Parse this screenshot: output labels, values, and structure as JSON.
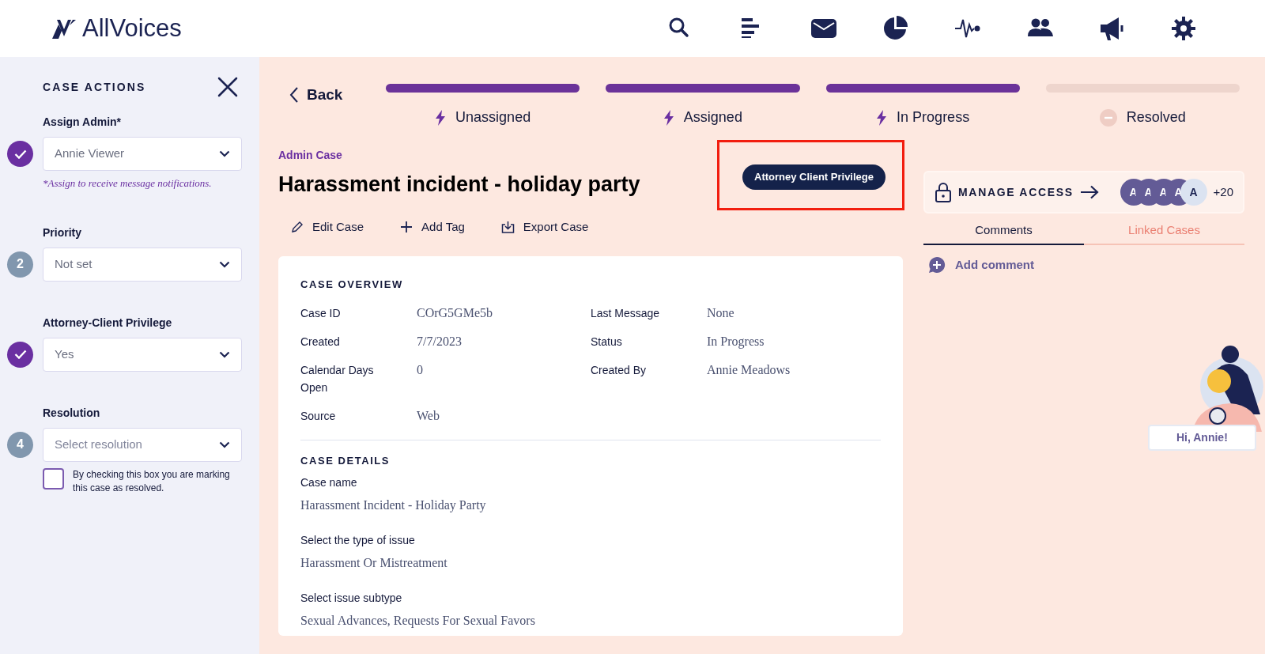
{
  "header": {
    "logo_text": "AllVoices"
  },
  "sidebar": {
    "title": "CASE ACTIONS",
    "steps": [
      {
        "label": "Assign Admin*",
        "value": "Annie Viewer",
        "completed": true,
        "hint": "*Assign to receive message notifications."
      },
      {
        "label": "Priority",
        "value": "Not set",
        "completed": false,
        "number": "2"
      },
      {
        "label": "Attorney-Client Privilege",
        "value": "Yes",
        "completed": true
      },
      {
        "label": "Resolution",
        "placeholder": "Select resolution",
        "completed": false,
        "number": "4"
      }
    ],
    "resolve_checkbox": {
      "label": "By checking this box you are marking this case as resolved.",
      "checked": false
    }
  },
  "back": "Back",
  "progress": [
    {
      "label": "Unassigned",
      "completed": true
    },
    {
      "label": "Assigned",
      "completed": true
    },
    {
      "label": "In Progress",
      "completed": true
    },
    {
      "label": "Resolved",
      "completed": false
    }
  ],
  "case": {
    "kicker": "Admin Case",
    "title": "Harassment incident - holiday party",
    "badge": {
      "label": "Attorney Client Privilege",
      "highlighted": true
    },
    "actions": [
      {
        "label": "Edit Case"
      },
      {
        "label": "Add Tag"
      },
      {
        "label": "Export Case"
      }
    ]
  },
  "overview": {
    "title": "CASE OVERVIEW",
    "fields": [
      {
        "label": "Case ID",
        "value": "COrG5GMe5b"
      },
      {
        "label": "Last Message",
        "value": "None"
      },
      {
        "label": "Created",
        "value": "7/7/2023"
      },
      {
        "label": "Status",
        "value": "In Progress"
      },
      {
        "label": "Calendar Days Open",
        "value": "0"
      },
      {
        "label": "Created By",
        "value": "Annie Meadows"
      },
      {
        "label": "Source",
        "value": "Web"
      }
    ]
  },
  "details": {
    "title": "CASE DETAILS",
    "fields": [
      {
        "label": "Case name",
        "value": "Harassment Incident - Holiday Party"
      },
      {
        "label": "Select the type of issue",
        "value": "Harassment Or Mistreatment"
      },
      {
        "label": "Select issue subtype",
        "value": "Sexual Advances, Requests For Sexual Favors"
      }
    ]
  },
  "access": {
    "label": "MANAGE ACCESS",
    "avatars": [
      {
        "initial": "A",
        "color": "#635b96"
      },
      {
        "initial": "A",
        "color": "#635b96"
      },
      {
        "initial": "A",
        "color": "#635b96"
      },
      {
        "initial": "A",
        "color": "#635b96"
      },
      {
        "initial": "A",
        "color": "#dbe3f1"
      }
    ],
    "more": "+20"
  },
  "tabs": [
    {
      "label": "Comments",
      "selected": true
    },
    {
      "label": "Linked Cases",
      "selected": false
    }
  ],
  "add_comment": "Add comment",
  "greeting": "Hi, Annie!"
}
